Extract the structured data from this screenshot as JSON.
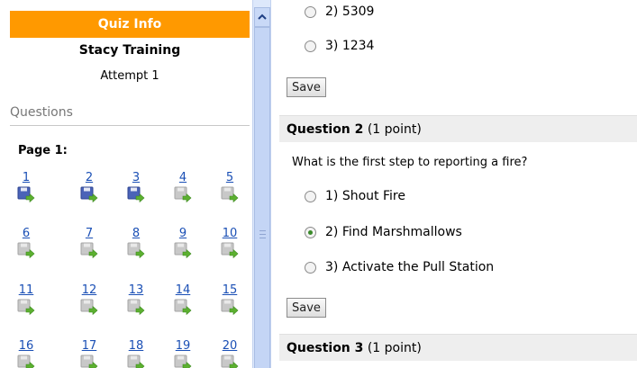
{
  "sidebar": {
    "header": "Quiz Info",
    "title": "Stacy Training",
    "attempt": "Attempt 1",
    "questions_heading": "Questions",
    "page_label": "Page 1:",
    "question_links": [
      {
        "num": "1",
        "saved": true
      },
      {
        "num": "2",
        "saved": true
      },
      {
        "num": "3",
        "saved": true
      },
      {
        "num": "4",
        "saved": false
      },
      {
        "num": "5",
        "saved": false
      },
      {
        "num": "6",
        "saved": false
      },
      {
        "num": "7",
        "saved": false
      },
      {
        "num": "8",
        "saved": false
      },
      {
        "num": "9",
        "saved": false
      },
      {
        "num": "10",
        "saved": false
      },
      {
        "num": "11",
        "saved": false
      },
      {
        "num": "12",
        "saved": false
      },
      {
        "num": "13",
        "saved": false
      },
      {
        "num": "14",
        "saved": false
      },
      {
        "num": "15",
        "saved": false
      },
      {
        "num": "16",
        "saved": false
      },
      {
        "num": "17",
        "saved": false
      },
      {
        "num": "18",
        "saved": false
      },
      {
        "num": "19",
        "saved": false
      },
      {
        "num": "20",
        "saved": false
      }
    ]
  },
  "main": {
    "q1": {
      "options": [
        {
          "label": "2)  5309",
          "checked": false
        },
        {
          "label": "3)  1234",
          "checked": false
        }
      ],
      "save_label": "Save"
    },
    "q2": {
      "title": "Question 2",
      "points": "(1 point)",
      "text": "What is the first step to reporting a fire?",
      "options": [
        {
          "label": "1)  Shout Fire",
          "checked": false
        },
        {
          "label": "2)  Find Marshmallows",
          "checked": true
        },
        {
          "label": "3)  Activate the Pull Station",
          "checked": false
        }
      ],
      "save_label": "Save"
    },
    "q3": {
      "title": "Question 3",
      "points": "(1 point)"
    }
  },
  "colors": {
    "header_bg": "#ff9900",
    "link": "#1a4fb5",
    "saved_icon": "#4a63b8",
    "unsaved_icon": "#c8c8c8",
    "arrow": "#5cb030"
  }
}
